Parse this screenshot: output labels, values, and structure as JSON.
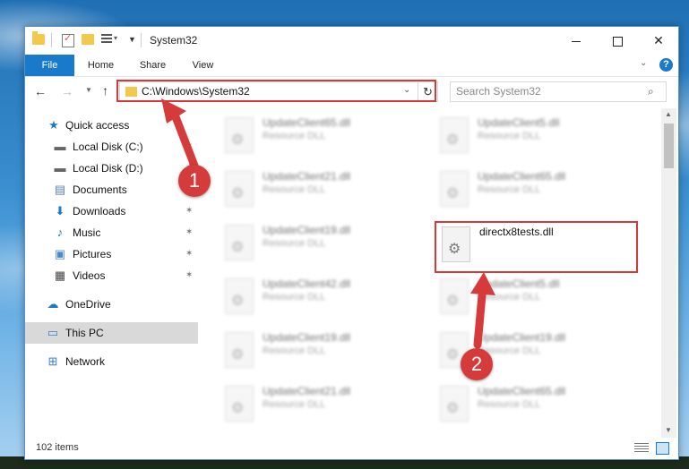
{
  "window": {
    "title": "System32",
    "minimize_icon": "minimize-icon",
    "maximize_icon": "maximize-icon",
    "close_label": "✕"
  },
  "ribbon": {
    "tabs": [
      "File",
      "Home",
      "Share",
      "View"
    ],
    "help_label": "?"
  },
  "navbar": {
    "address": "C:\\Windows\\System32",
    "search_placeholder": "Search System32"
  },
  "sidebar": {
    "items": [
      {
        "label": "Quick access",
        "icon": "star-icon",
        "pinned": false
      },
      {
        "label": "Local Disk (C:)",
        "icon": "drive-icon",
        "pinned": true
      },
      {
        "label": "Local Disk (D:)",
        "icon": "drive-icon",
        "pinned": true
      },
      {
        "label": "Documents",
        "icon": "documents-icon",
        "pinned": true
      },
      {
        "label": "Downloads",
        "icon": "download-icon",
        "pinned": true
      },
      {
        "label": "Music",
        "icon": "music-icon",
        "pinned": true
      },
      {
        "label": "Pictures",
        "icon": "pictures-icon",
        "pinned": true
      },
      {
        "label": "Videos",
        "icon": "videos-icon",
        "pinned": true
      },
      {
        "label": "OneDrive",
        "icon": "cloud-icon",
        "pinned": false
      },
      {
        "label": "This PC",
        "icon": "computer-icon",
        "pinned": false,
        "selected": true
      },
      {
        "label": "Network",
        "icon": "network-icon",
        "pinned": false
      }
    ]
  },
  "files": [
    {
      "name": "UpdateClient65.dll",
      "type": "Resource DLL"
    },
    {
      "name": "UpdateClient5.dll",
      "type": "Resource DLL"
    },
    {
      "name": "UpdateClient21.dll",
      "type": "Resource DLL"
    },
    {
      "name": "UpdateClient65.dll",
      "type": "Resource DLL"
    },
    {
      "name": "UpdateClient19.dll",
      "type": "Resource DLL"
    },
    {
      "name": "directx8tests.dll",
      "type": ""
    },
    {
      "name": "UpdateClient42.dll",
      "type": "Resource DLL"
    },
    {
      "name": "UpdateClient5.dll",
      "type": "Resource DLL"
    },
    {
      "name": "UpdateClient19.dll",
      "type": "Resource DLL"
    },
    {
      "name": "UpdateClient19.dll",
      "type": "Resource DLL"
    },
    {
      "name": "UpdateClient21.dll",
      "type": "Resource DLL"
    },
    {
      "name": "UpdateClient65.dll",
      "type": "Resource DLL"
    }
  ],
  "status": {
    "item_count": "102 items"
  },
  "callouts": [
    "1",
    "2"
  ],
  "colors": {
    "accent": "#1979ca",
    "highlight": "#d9383a",
    "folder": "#f2c94c"
  }
}
